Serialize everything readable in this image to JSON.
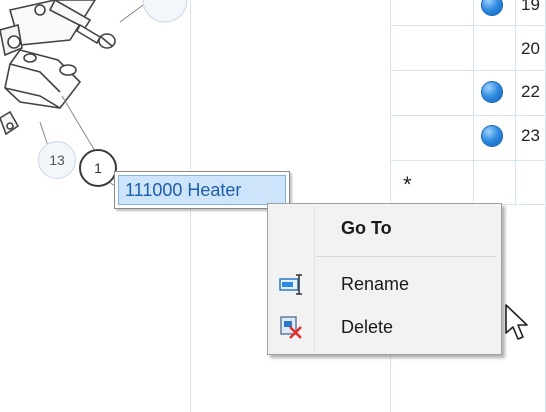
{
  "diagram": {
    "callouts": [
      "13",
      "1"
    ],
    "tag_label": "111000 Heater"
  },
  "grid": {
    "rows": [
      {
        "icon": "blue-dot",
        "value": "19"
      },
      {
        "icon": "",
        "value": "20"
      },
      {
        "icon": "blue-dot",
        "value": "22"
      },
      {
        "icon": "blue-dot",
        "value": "23"
      }
    ],
    "new_row_marker": "*"
  },
  "context_menu": {
    "items": [
      {
        "label": "Go To",
        "icon": "",
        "bold": true
      },
      {
        "label": "Rename",
        "icon": "rename-icon"
      },
      {
        "label": "Delete",
        "icon": "delete-icon"
      }
    ]
  },
  "colors": {
    "dot_blue": "#2f8be0",
    "tag_fill": "#cde4fb",
    "tag_text": "#1d5fa8",
    "menu_bg": "#f2f2f2"
  }
}
